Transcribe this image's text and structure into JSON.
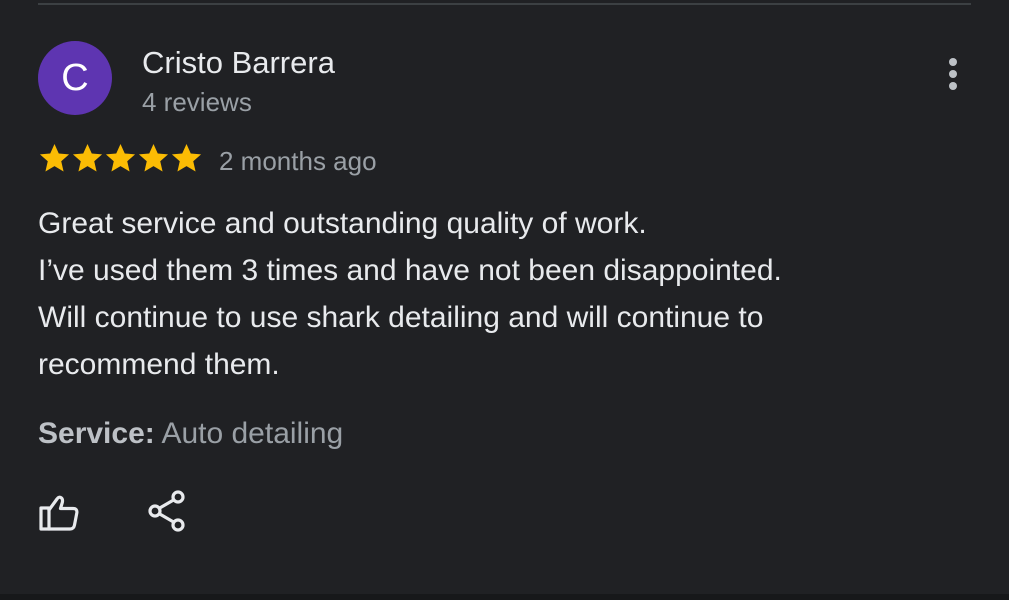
{
  "review": {
    "author": {
      "initial": "C",
      "name": "Cristo Barrera",
      "reviews_count": "4 reviews",
      "avatar_color": "#5e35b1"
    },
    "rating": 5,
    "rating_max": 5,
    "star_color": "#fbbc04",
    "date": "2 months ago",
    "text_lines": [
      "Great service and outstanding quality of work.",
      "I’ve used them 3 times and have not been disappointed.",
      "Will continue to use shark detailing and will continue to",
      "recommend them."
    ],
    "service": {
      "label": "Service:",
      "value": "Auto detailing"
    }
  },
  "icons": {
    "more": "more-vertical-icon",
    "like": "thumbs-up-icon",
    "share": "share-icon"
  }
}
